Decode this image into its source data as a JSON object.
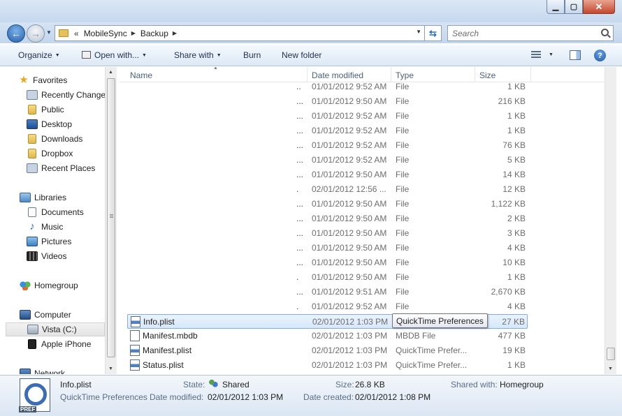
{
  "window": {
    "title": "",
    "minimize_glyph": "▁",
    "maximize_glyph": "▢",
    "close_glyph": "✕"
  },
  "nav": {
    "back_glyph": "←",
    "forward_glyph": "→",
    "history_glyph": "▼",
    "overflow_glyph": "«",
    "breadcrumbs": [
      "MobileSync",
      "Backup"
    ],
    "crumb_sep": "▶",
    "address_drop_glyph": "▼",
    "refresh_glyph": "⇆"
  },
  "search": {
    "placeholder": "Search"
  },
  "toolbar": {
    "organize": "Organize",
    "open_with": "Open with...",
    "share_with": "Share with",
    "burn": "Burn",
    "new_folder": "New folder",
    "dropdown_glyph": "▼",
    "help_glyph": "?"
  },
  "sidebar": {
    "favorites": "Favorites",
    "favorite_items": [
      "Recently Changed",
      "Public",
      "Desktop",
      "Downloads",
      "Dropbox",
      "Recent Places"
    ],
    "libraries": "Libraries",
    "library_items": [
      "Documents",
      "Music",
      "Pictures",
      "Videos"
    ],
    "homegroup": "Homegroup",
    "computer": "Computer",
    "computer_items": [
      "Vista (C:)",
      "Apple iPhone"
    ],
    "network": "Network"
  },
  "columns": {
    "name": "Name",
    "date_modified": "Date modified",
    "type": "Type",
    "size": "Size"
  },
  "rows": [
    {
      "name": "",
      "dots": "..",
      "date": "01/01/2012 9:52 AM",
      "type": "File",
      "size": "1 KB"
    },
    {
      "name": "",
      "dots": "...",
      "date": "01/01/2012 9:50 AM",
      "type": "File",
      "size": "216 KB"
    },
    {
      "name": "",
      "dots": "...",
      "date": "01/01/2012 9:52 AM",
      "type": "File",
      "size": "1 KB"
    },
    {
      "name": "",
      "dots": "...",
      "date": "01/01/2012 9:52 AM",
      "type": "File",
      "size": "1 KB"
    },
    {
      "name": "",
      "dots": "...",
      "date": "01/01/2012 9:52 AM",
      "type": "File",
      "size": "76 KB"
    },
    {
      "name": "",
      "dots": "...",
      "date": "01/01/2012 9:52 AM",
      "type": "File",
      "size": "5 KB"
    },
    {
      "name": "",
      "dots": "...",
      "date": "01/01/2012 9:50 AM",
      "type": "File",
      "size": "14 KB"
    },
    {
      "name": "",
      "dots": ".",
      "date": "02/01/2012 12:56 ...",
      "type": "File",
      "size": "12 KB"
    },
    {
      "name": "",
      "dots": "...",
      "date": "01/01/2012 9:50 AM",
      "type": "File",
      "size": "1,122 KB"
    },
    {
      "name": "",
      "dots": "...",
      "date": "01/01/2012 9:50 AM",
      "type": "File",
      "size": "2 KB"
    },
    {
      "name": "",
      "dots": "...",
      "date": "01/01/2012 9:50 AM",
      "type": "File",
      "size": "3 KB"
    },
    {
      "name": "",
      "dots": "...",
      "date": "01/01/2012 9:50 AM",
      "type": "File",
      "size": "4 KB"
    },
    {
      "name": "",
      "dots": "...",
      "date": "01/01/2012 9:50 AM",
      "type": "File",
      "size": "10 KB"
    },
    {
      "name": "",
      "dots": ".",
      "date": "01/01/2012 9:50 AM",
      "type": "File",
      "size": "1 KB"
    },
    {
      "name": "",
      "dots": "...",
      "date": "01/01/2012 9:51 AM",
      "type": "File",
      "size": "2,670 KB"
    },
    {
      "name": "",
      "dots": ".",
      "date": "01/01/2012 9:52 AM",
      "type": "File",
      "size": "4 KB"
    },
    {
      "name": "Info.plist",
      "dots": "",
      "date": "02/01/2012 1:03 PM",
      "type": "QuickTime Preferences",
      "size": "27 KB"
    },
    {
      "name": "Manifest.mbdb",
      "dots": "",
      "date": "02/01/2012 1:03 PM",
      "type": "MBDB File",
      "size": "477 KB"
    },
    {
      "name": "Manifest.plist",
      "dots": "",
      "date": "02/01/2012 1:03 PM",
      "type": "QuickTime Prefer...",
      "size": "19 KB"
    },
    {
      "name": "Status.plist",
      "dots": "",
      "date": "02/01/2012 1:03 PM",
      "type": "QuickTime Prefer...",
      "size": "1 KB"
    }
  ],
  "tooltip": "QuickTime Preferences",
  "details": {
    "filename": "Info.plist",
    "filetype": "QuickTime Preferences",
    "state_label": "State:",
    "state_value": "Shared",
    "size_label": "Size:",
    "size_value": "26.8 KB",
    "shared_label": "Shared with:",
    "shared_value": "Homegroup",
    "modified_label": "Date modified:",
    "modified_value": "02/01/2012 1:03 PM",
    "created_label": "Date created:",
    "created_value": "02/01/2012 1:08 PM",
    "icon_badge": "PREF"
  }
}
